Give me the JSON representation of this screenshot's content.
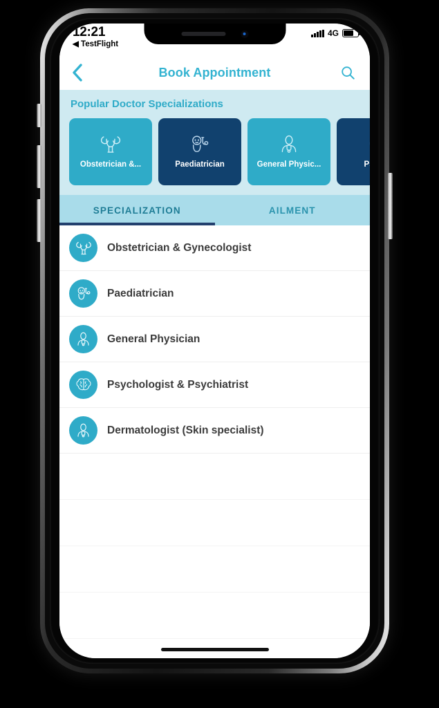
{
  "status_bar": {
    "time": "12:21",
    "back_app": "◀ TestFlight",
    "network": "4G",
    "signal_icon": "signal-bars-icon",
    "battery_icon": "battery-icon"
  },
  "nav": {
    "back_icon": "chevron-left-icon",
    "title": "Book Appointment",
    "search_icon": "search-icon"
  },
  "popular": {
    "title": "Popular Doctor Specializations",
    "cards": [
      {
        "label": "Obstetrician &...",
        "icon": "uterus-icon",
        "color": "#2fabc8"
      },
      {
        "label": "Paediatrician",
        "icon": "baby-stethoscope-icon",
        "color": "#11416e"
      },
      {
        "label": "General Physic...",
        "icon": "doctor-icon",
        "color": "#2fabc8"
      },
      {
        "label": "Psycho",
        "icon": "brain-icon",
        "color": "#11416e"
      }
    ]
  },
  "tabs": [
    {
      "label": "SPECIALIZATION",
      "active": true
    },
    {
      "label": "AILMENT",
      "active": false
    }
  ],
  "list": [
    {
      "label": "Obstetrician & Gynecologist",
      "icon": "uterus-icon"
    },
    {
      "label": "Paediatrician",
      "icon": "baby-stethoscope-icon"
    },
    {
      "label": "General Physician",
      "icon": "doctor-icon"
    },
    {
      "label": "Psychologist & Psychiatrist",
      "icon": "brain-icon"
    },
    {
      "label": "Dermatologist (Skin specialist)",
      "icon": "doctor-icon"
    }
  ],
  "colors": {
    "teal": "#2fabc8",
    "navy": "#11416e",
    "header_bg": "#cfeaf1",
    "tab_bg": "#a9dcea",
    "title_teal": "#33b3d1"
  }
}
